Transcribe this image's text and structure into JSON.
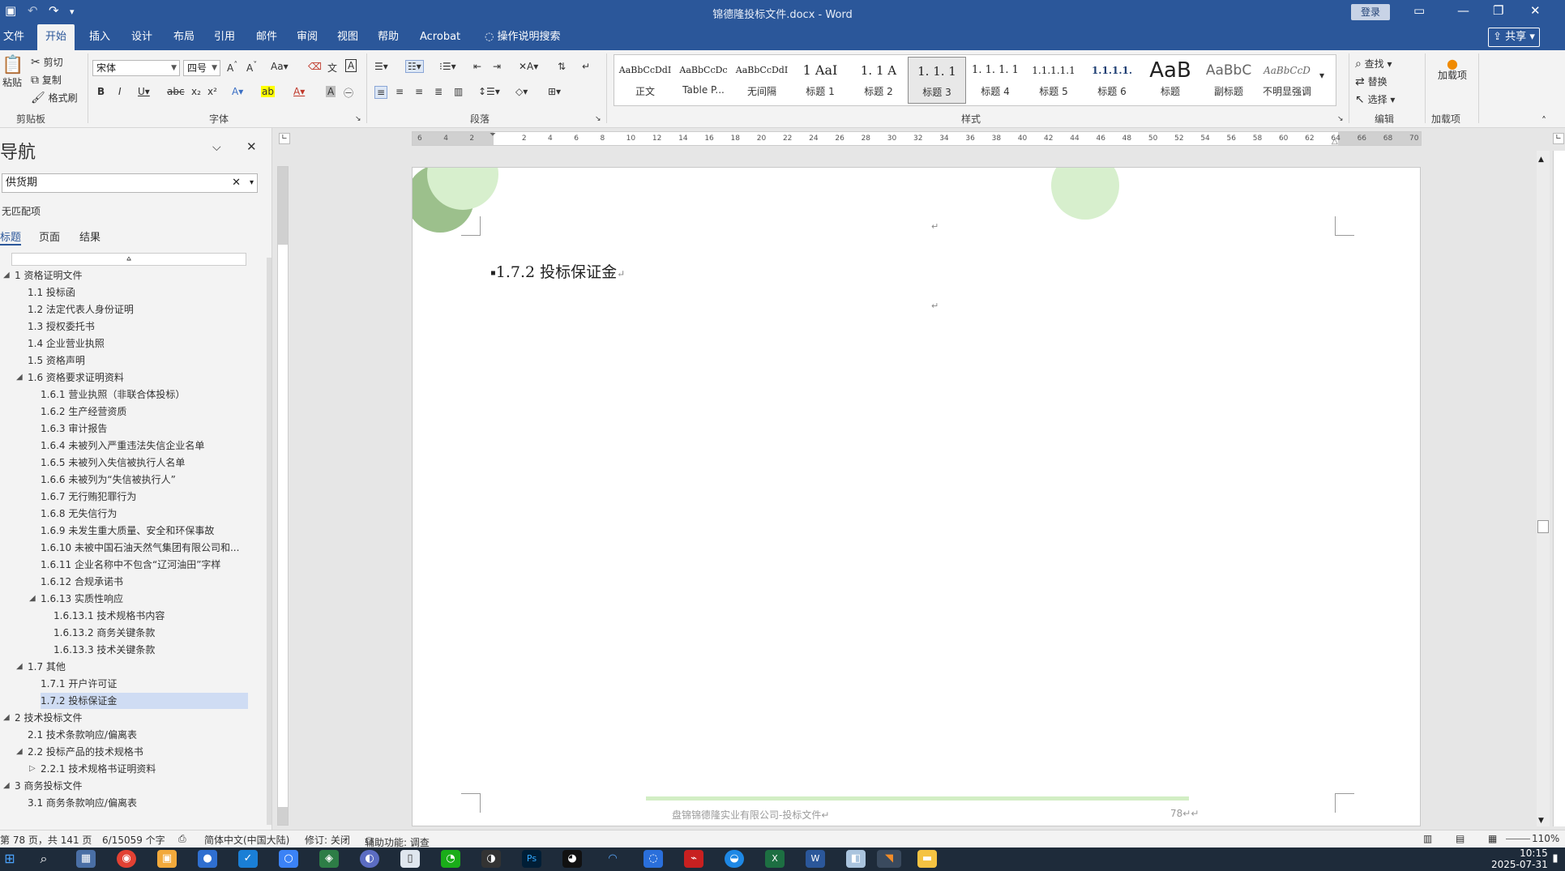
{
  "window": {
    "title": "锦德隆投标文件.docx  -  Word",
    "login": "登录"
  },
  "tabs": [
    "文件",
    "开始",
    "插入",
    "设计",
    "布局",
    "引用",
    "邮件",
    "审阅",
    "视图",
    "帮助",
    "Acrobat"
  ],
  "tell_me": "操作说明搜索",
  "share": "共享",
  "clipboard": {
    "paste": "粘贴",
    "cut": "剪切",
    "copy": "复制",
    "format_painter": "格式刷",
    "label": "剪贴板"
  },
  "font": {
    "name": "宋体",
    "size": "四号",
    "label": "字体"
  },
  "paragraph": {
    "label": "段落"
  },
  "styles": {
    "label": "样式",
    "items": [
      {
        "preview": "AaBbCcDdI",
        "name": "正文"
      },
      {
        "preview": "AaBbCcDc",
        "name": "Table P..."
      },
      {
        "preview": "AaBbCcDdI",
        "name": "无间隔"
      },
      {
        "preview": "1  AaI",
        "name": "标题 1"
      },
      {
        "preview": "1. 1  A",
        "name": "标题 2"
      },
      {
        "preview": "1. 1. 1",
        "name": "标题 3"
      },
      {
        "preview": "1. 1. 1. 1",
        "name": "标题 4"
      },
      {
        "preview": "1.1.1.1.1",
        "name": "标题 5"
      },
      {
        "preview": "1.1.1.1.",
        "name": "标题 6"
      },
      {
        "preview": "AaB",
        "name": "标题"
      },
      {
        "preview": "AaBbC",
        "name": "副标题"
      },
      {
        "preview": "AaBbCcD",
        "name": "不明显强调"
      }
    ]
  },
  "editing": {
    "find": "查找",
    "replace": "替换",
    "select": "选择",
    "label": "编辑"
  },
  "addins": {
    "button": "加载项",
    "label": "加载项"
  },
  "nav": {
    "title": "导航",
    "search_value": "供货期",
    "no_match": "无匹配项",
    "tabs": [
      "标题",
      "页面",
      "结果"
    ],
    "tree": [
      {
        "text": "1 资格证明文件",
        "level": 0,
        "arrow": "◢"
      },
      {
        "text": "1.1 投标函",
        "level": 1
      },
      {
        "text": "1.2 法定代表人身份证明",
        "level": 1
      },
      {
        "text": "1.3 授权委托书",
        "level": 1
      },
      {
        "text": "1.4 企业营业执照",
        "level": 1
      },
      {
        "text": "1.5 资格声明",
        "level": 1
      },
      {
        "text": "1.6 资格要求证明资料",
        "level": 1,
        "arrow": "◢"
      },
      {
        "text": "1.6.1 营业执照（非联合体投标）",
        "level": 2
      },
      {
        "text": "1.6.2 生产经营资质",
        "level": 2
      },
      {
        "text": "1.6.3 审计报告",
        "level": 2
      },
      {
        "text": "1.6.4 未被列入严重违法失信企业名单",
        "level": 2
      },
      {
        "text": "1.6.5 未被列入失信被执行人名单",
        "level": 2
      },
      {
        "text": "1.6.6 未被列为“失信被执行人”",
        "level": 2
      },
      {
        "text": "1.6.7 无行贿犯罪行为",
        "level": 2
      },
      {
        "text": "1.6.8 无失信行为",
        "level": 2
      },
      {
        "text": "1.6.9 未发生重大质量、安全和环保事故",
        "level": 2
      },
      {
        "text": "1.6.10 未被中国石油天然气集团有限公司和...",
        "level": 2
      },
      {
        "text": "1.6.11 企业名称中不包含“辽河油田”字样",
        "level": 2
      },
      {
        "text": "1.6.12 合规承诺书",
        "level": 2
      },
      {
        "text": "1.6.13 实质性响应",
        "level": 2,
        "arrow": "◢"
      },
      {
        "text": "1.6.13.1 技术规格书内容",
        "level": 3
      },
      {
        "text": "1.6.13.2 商务关键条款",
        "level": 3
      },
      {
        "text": "1.6.13.3 技术关键条款",
        "level": 3
      },
      {
        "text": "1.7 其他",
        "level": 1,
        "arrow": "◢"
      },
      {
        "text": "1.7.1 开户许可证",
        "level": 2
      },
      {
        "text": "1.7.2 投标保证金",
        "level": 2,
        "selected": true
      },
      {
        "text": "2 技术投标文件",
        "level": 0,
        "arrow": "◢"
      },
      {
        "text": "2.1 技术条款响应/偏离表",
        "level": 1
      },
      {
        "text": "2.2 投标产品的技术规格书",
        "level": 1,
        "arrow": "◢"
      },
      {
        "text": "2.2.1 技术规格书证明资料",
        "level": 2,
        "arrow": "▷"
      },
      {
        "text": "3 商务投标文件",
        "level": 0,
        "arrow": "◢"
      },
      {
        "text": "3.1 商务条款响应/偏离表",
        "level": 1
      }
    ]
  },
  "hruler_ticks": [
    "6",
    "4",
    "2",
    "",
    "2",
    "4",
    "6",
    "8",
    "10",
    "12",
    "14",
    "16",
    "18",
    "20",
    "22",
    "24",
    "26",
    "28",
    "30",
    "32",
    "34",
    "36",
    "38",
    "40",
    "42",
    "44",
    "46",
    "48",
    "50",
    "52",
    "54",
    "56",
    "58",
    "60",
    "62",
    "64",
    "66",
    "68",
    "70"
  ],
  "document": {
    "heading": "1.7.2  投标保证金",
    "para_mark": "↵",
    "footer_text": "盘锦锦德隆实业有限公司-投标文件↵",
    "footer_page": "78↵↵"
  },
  "status": {
    "page": "第 78 页，共 141 页",
    "words": "6/15059 个字",
    "language": "简体中文(中国大陆)",
    "track": "修订: 关闭",
    "accessibility": "辅助功能: 调查",
    "zoom": "110%"
  },
  "clock": {
    "time": "10:15",
    "date": "2025-07-31"
  },
  "colors": {
    "brand": "#2b579a",
    "nav_selected": "#cfdcf3",
    "taskbar": "#1e2b3a"
  }
}
